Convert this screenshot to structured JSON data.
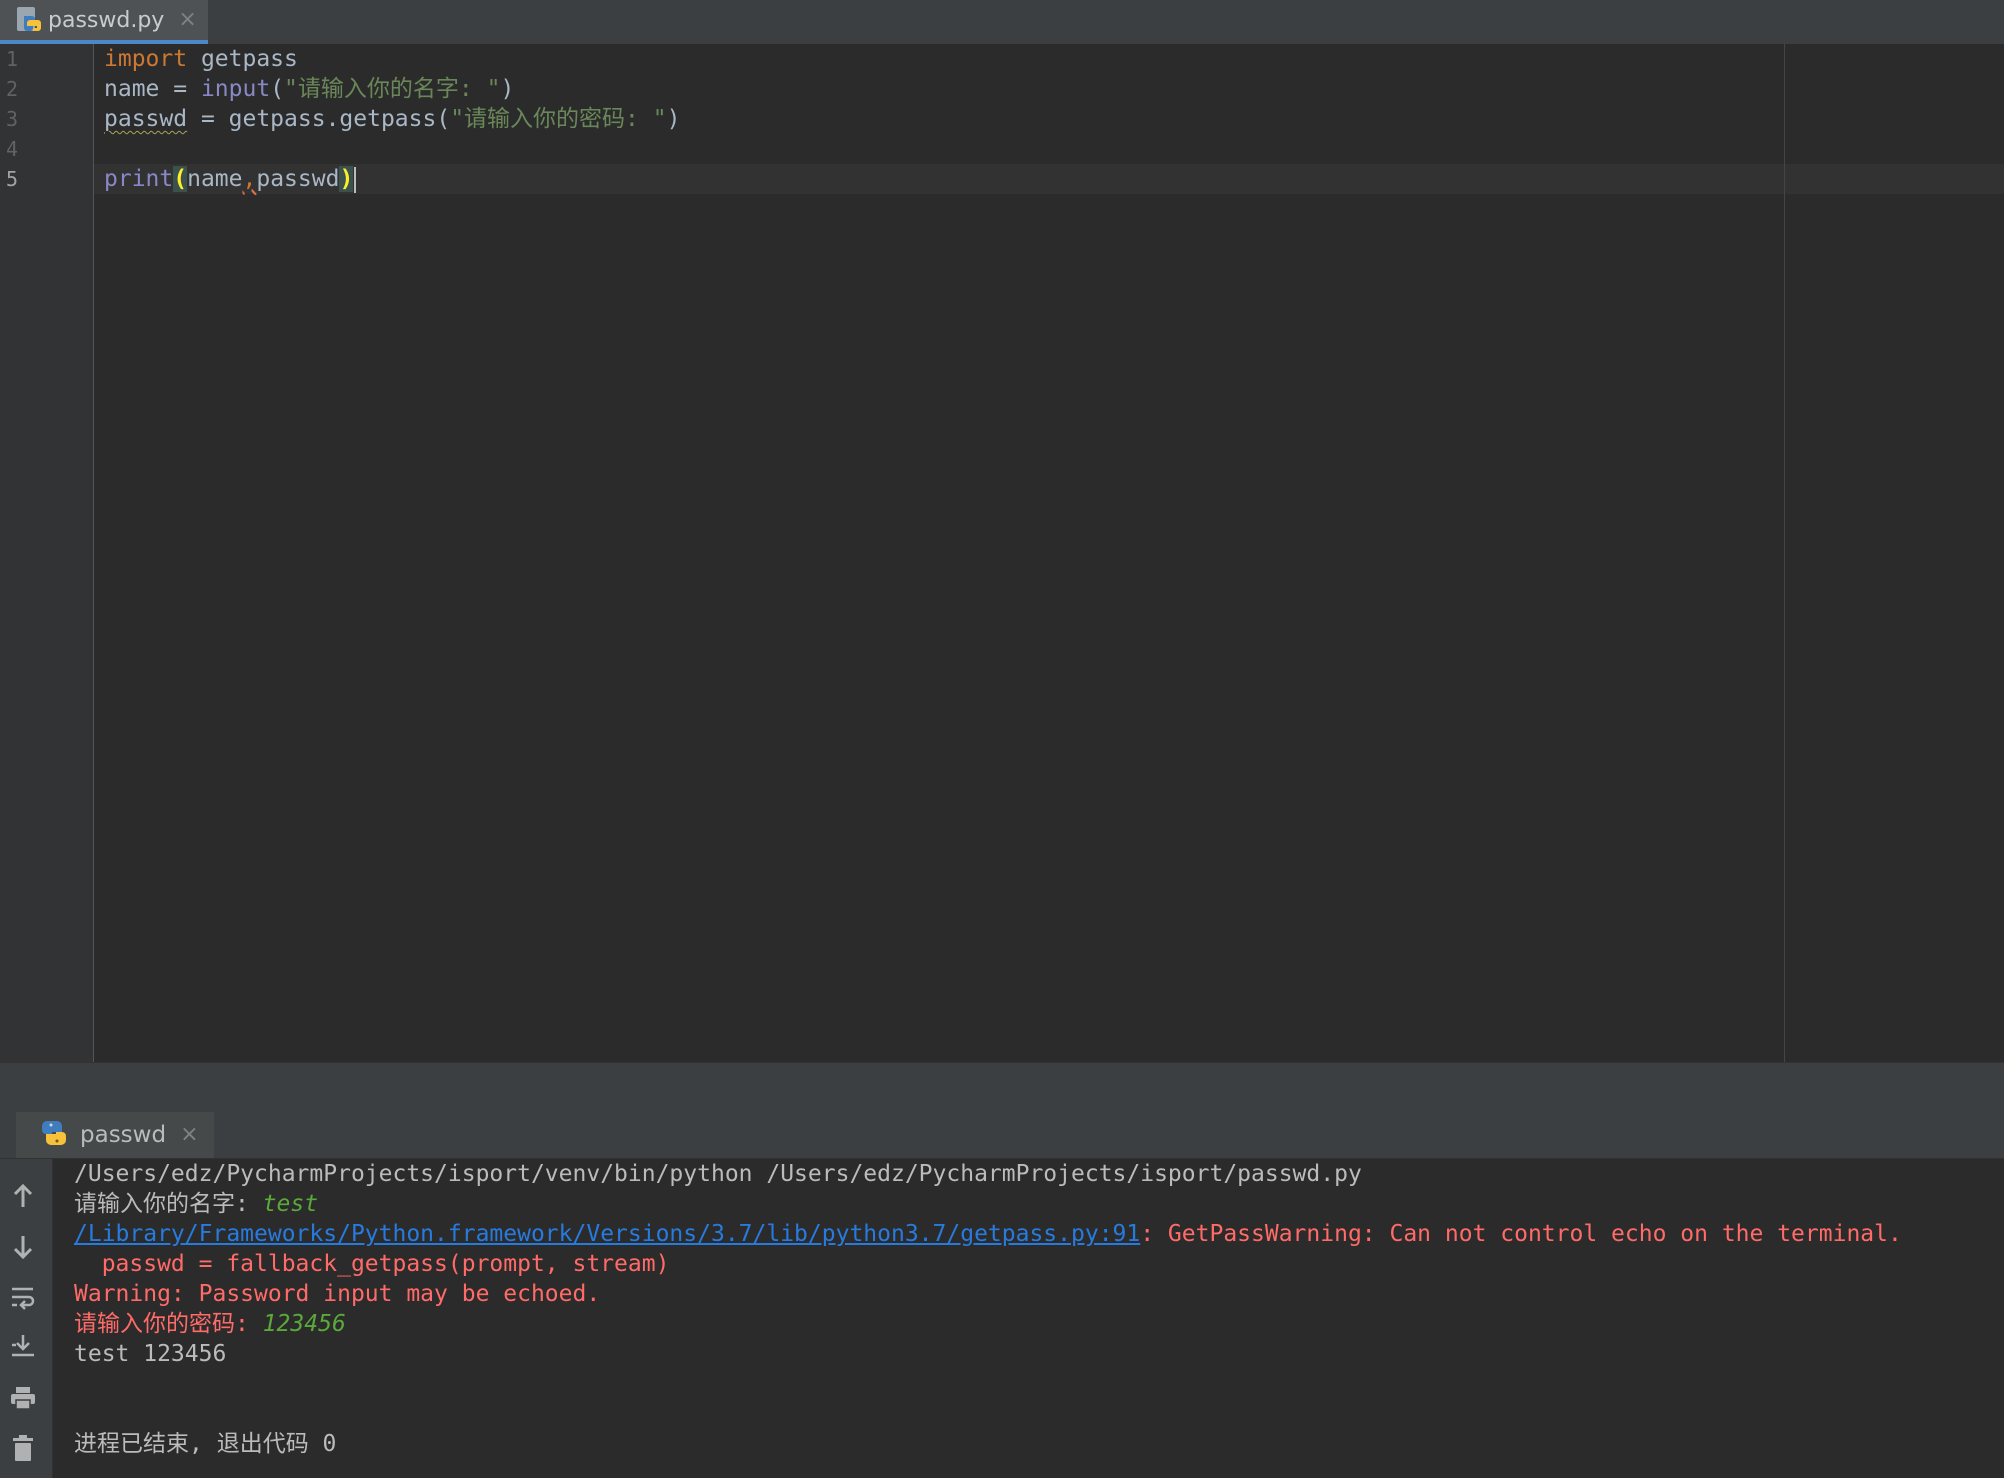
{
  "editor": {
    "tab": {
      "filename": "passwd.py",
      "close": "×"
    },
    "line_numbers": [
      "1",
      "2",
      "3",
      "4",
      "5"
    ],
    "current_line": "5",
    "code": {
      "line1": {
        "keyword": "import",
        "rest": " getpass"
      },
      "line2": {
        "var": "name = ",
        "builtin": "input",
        "open": "(",
        "string": "\"请输入你的名字: \"",
        "close": ")"
      },
      "line3": {
        "var": "passwd",
        "rest": " = getpass.getpass(",
        "string": "\"请输入你的密码: \"",
        "close": ")"
      },
      "line5": {
        "builtin": "print",
        "open": "(",
        "arg1": "name",
        "comma": ",",
        "arg2": "passwd",
        "close": ")"
      }
    }
  },
  "run": {
    "tab": {
      "label": "passwd",
      "close": "×"
    },
    "toolbar": [
      "arrow-up-icon",
      "arrow-down-icon",
      "soft-wrap-icon",
      "scroll-to-end-icon",
      "print-icon",
      "trash-icon"
    ],
    "console": {
      "command": "/Users/edz/PycharmProjects/isport/venv/bin/python /Users/edz/PycharmProjects/isport/passwd.py",
      "prompt_name": "请输入你的名字: ",
      "input_name": "test",
      "warning_link": "/Library/Frameworks/Python.framework/Versions/3.7/lib/python3.7/getpass.py:91",
      "warning_text": ": GetPassWarning: Can not control echo on the terminal.",
      "warning_code": "  passwd = fallback_getpass(prompt, stream)",
      "warning_echo": "Warning: Password input may be echoed.",
      "prompt_passwd": "请输入你的密码: ",
      "input_passwd": "123456",
      "output": "test 123456",
      "exit": "进程已结束, 退出代码 0"
    }
  },
  "colors": {
    "keyword": "#cc7832",
    "builtin": "#8888c6",
    "string": "#6a8759",
    "error": "#ff6b68",
    "user_input": "#5ba93b",
    "link": "#287bde"
  }
}
